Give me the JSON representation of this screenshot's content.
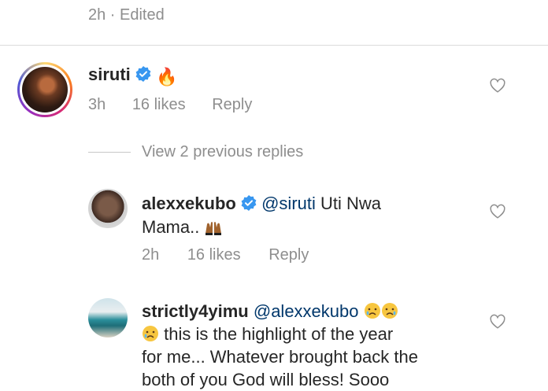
{
  "top_comment": {
    "meta": "2h · Edited"
  },
  "comment1": {
    "username": "siruti",
    "emoji": "🔥",
    "time": "3h",
    "likes": "16 likes",
    "reply": "Reply"
  },
  "view_replies": "View 2 previous replies",
  "reply1": {
    "username": "alexxekubo",
    "mention": "@siruti",
    "text_line1": "Uti Nwa",
    "text_line2": "Mama..",
    "time": "2h",
    "likes": "16 likes",
    "reply": "Reply"
  },
  "reply2": {
    "username": "strictly4yimu",
    "mention": "@alexxekubo",
    "text_line1": "this is the highlight of the year",
    "text_line2": "for me... Whatever brought back the",
    "text_line3": "both of you God will bless! Sooo"
  },
  "colors": {
    "text": "#262626",
    "meta": "#8e8e8e",
    "mention": "#00376b",
    "verified": "#3897f0",
    "divider": "#dbdbdb"
  }
}
